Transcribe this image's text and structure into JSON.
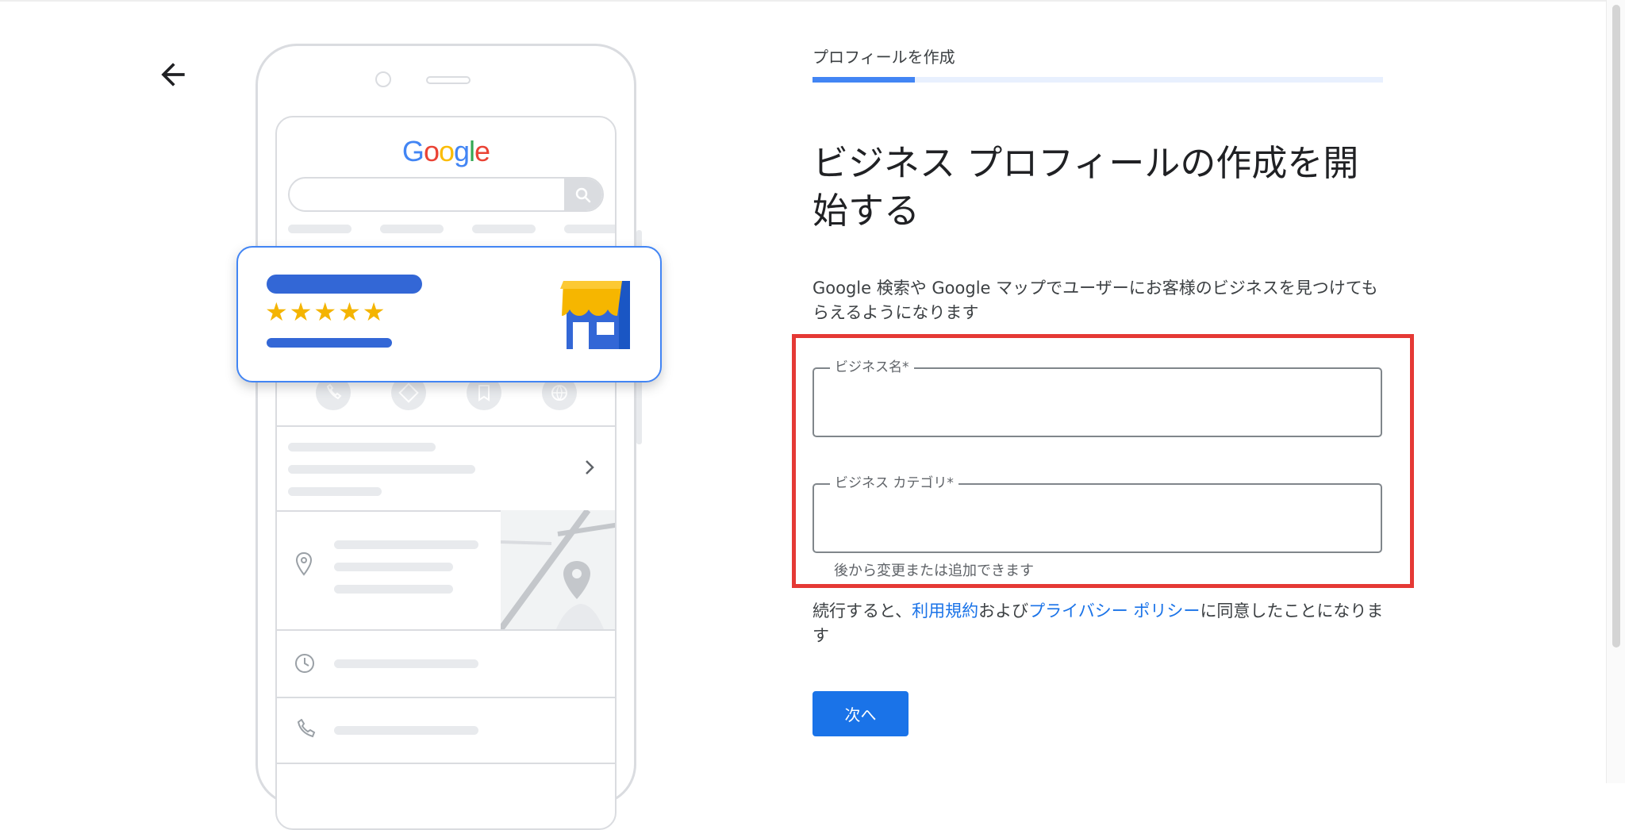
{
  "header": {
    "back_icon": "arrow-back-icon",
    "step_label": "プロフィールを作成",
    "progress": 0.18
  },
  "illustration": {
    "logo_text": "Google",
    "logo_letter_colors": [
      "#4285f4",
      "#ea4335",
      "#fbbc05",
      "#4285f4",
      "#34a853",
      "#ea4335"
    ],
    "stars": "★★★★★",
    "icons": [
      "search-icon",
      "phone-icon",
      "directions-icon",
      "bookmark-icon",
      "globe-icon",
      "chevron-right-icon",
      "location-pin-icon",
      "clock-icon",
      "store-icon"
    ]
  },
  "main": {
    "heading": "ビジネス プロフィールの作成を開始する",
    "description": "Google 検索や Google マップでユーザーにお客様のビジネスを見つけてもらえるようになります",
    "fields": [
      {
        "label": "ビジネス名*",
        "value": ""
      },
      {
        "label": "ビジネス カテゴリ*",
        "value": "",
        "helper": "後から変更または追加できます"
      }
    ],
    "consent": {
      "prefix": "続行すると、",
      "terms_link": "利用規約",
      "middle": "および",
      "privacy_link": "プライバシー ポリシー",
      "suffix": "に同意したことになります"
    },
    "next_button": "次へ"
  },
  "colors": {
    "accent": "#1a73e8",
    "highlight_border": "#e53935",
    "star": "#f4b400"
  }
}
